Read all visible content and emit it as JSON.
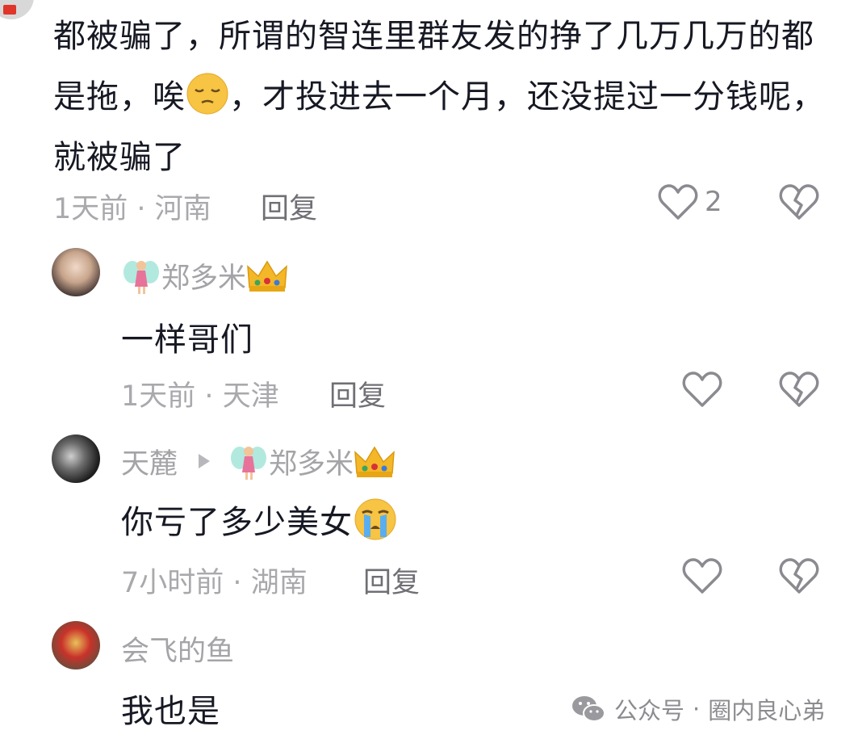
{
  "top_comment": {
    "text_part1": "都被骗了，所谓的智连里群友发的挣了几万几万的都是拖，唉",
    "text_part2": "，才投进去一个月，还没提过一分钱呢，就被骗了",
    "time": "1天前",
    "location": "河南",
    "reply_label": "回复",
    "like_count": "2"
  },
  "replies": [
    {
      "username": "郑多米",
      "text": "一样哥们",
      "time": "1天前",
      "location": "天津",
      "reply_label": "回复"
    },
    {
      "username": "天麓",
      "reply_to": "郑多米",
      "text": "你亏了多少美女",
      "time": "7小时前",
      "location": "湖南",
      "reply_label": "回复"
    },
    {
      "username": "会飞的鱼",
      "text": "我也是"
    }
  ],
  "meta_separator": "·",
  "watermark": {
    "prefix": "公众号",
    "separator": "·",
    "name": "圈内良心弟"
  },
  "icons": {
    "like": "heart-outline-icon",
    "dislike": "broken-heart-icon",
    "fairy": "fairy-emoji-icon",
    "crown": "crown-emoji-icon",
    "pensive": "pensive-face-emoji",
    "crying": "crying-face-emoji",
    "wechat": "wechat-icon"
  }
}
